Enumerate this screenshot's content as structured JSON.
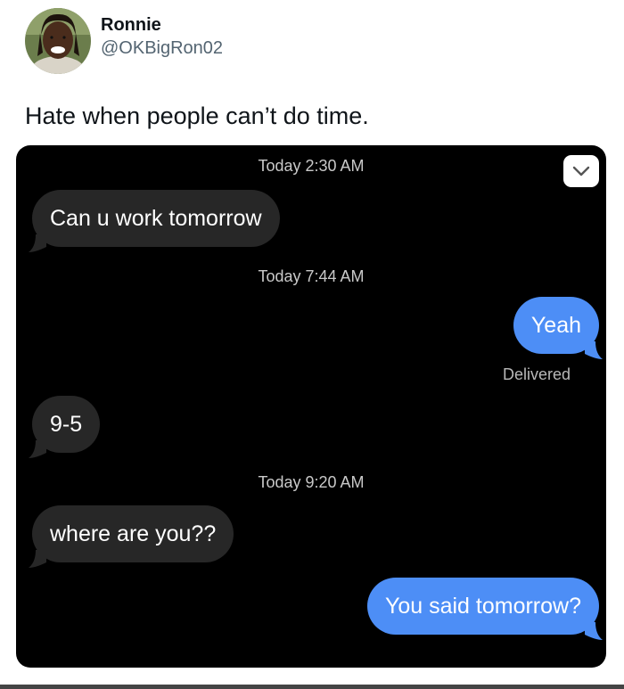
{
  "author": {
    "display_name": "Ronnie",
    "handle": "@OKBigRon02",
    "avatar_icon": "profile-photo"
  },
  "tweet": {
    "text": "Hate when people can’t do time."
  },
  "conversation": {
    "timestamps": [
      "Today 2:30 AM",
      "Today 7:44 AM",
      "Today 9:20 AM"
    ],
    "messages": [
      {
        "text": "Can u work tomorrow",
        "direction": "received"
      },
      {
        "text": "Yeah",
        "direction": "sent"
      },
      {
        "text": "9-5",
        "direction": "received"
      },
      {
        "text": "where are you??",
        "direction": "received"
      },
      {
        "text": "You said tomorrow?",
        "direction": "sent"
      }
    ],
    "delivered_label": "Delivered",
    "chevron_icon": "chevron-down-icon"
  },
  "colors": {
    "sent_bubble": "#4d8ef6",
    "received_bubble": "#272727",
    "background": "#000000"
  }
}
